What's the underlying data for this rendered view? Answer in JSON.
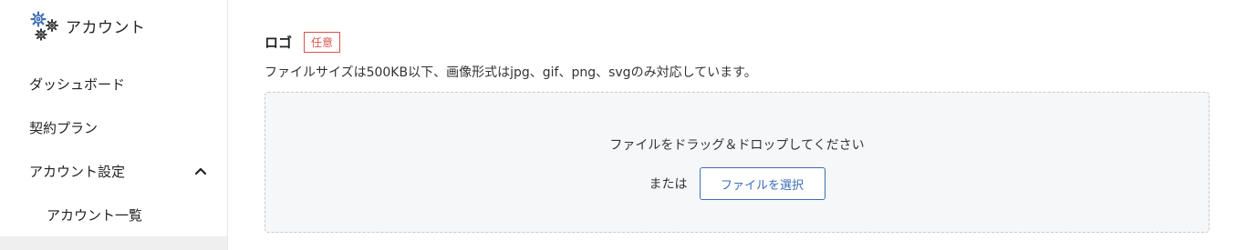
{
  "sidebar": {
    "brand": {
      "label": "アカウント",
      "icon": "gears-icon"
    },
    "items": [
      {
        "label": "ダッシュボード"
      },
      {
        "label": "契約プラン"
      },
      {
        "label": "アカウント設定",
        "expanded": true,
        "icon": "chevron-up-icon"
      },
      {
        "label": "アカウント一覧"
      }
    ]
  },
  "field": {
    "title": "ロゴ",
    "badge": "任意",
    "help": "ファイルサイズは500KB以下、画像形式はjpg、gif、png、svgのみ対応しています。"
  },
  "dropzone": {
    "prompt": "ファイルをドラッグ＆ドロップしてください",
    "or": "または",
    "button": "ファイルを選択"
  },
  "colors": {
    "accent": "#3d6db5",
    "badge": "#d9534f",
    "dropzone_bg": "#f6f7f9"
  }
}
